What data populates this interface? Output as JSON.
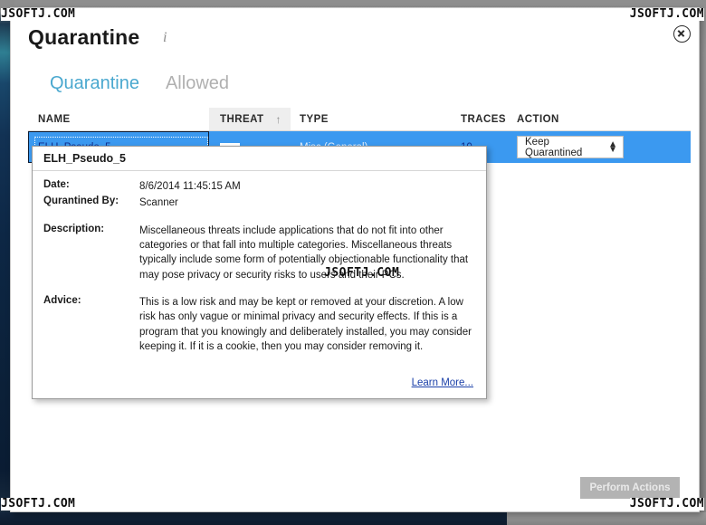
{
  "window": {
    "title": "Quarantine",
    "info_icon": "info-icon",
    "close_icon": "close-icon"
  },
  "tabs": [
    {
      "label": "Quarantine",
      "active": true
    },
    {
      "label": "Allowed",
      "active": false
    }
  ],
  "table": {
    "columns": [
      "NAME",
      "THREAT",
      "TYPE",
      "TRACES",
      "ACTION"
    ],
    "sorted_column": "THREAT",
    "sort_direction": "ascending",
    "sort_arrow": "↑",
    "rows": [
      {
        "name": "ELH_Pseudo_5",
        "threat_level_bar": "low",
        "type": "Misc (General)",
        "traces": "10",
        "action": "Keep Quarantined",
        "selected": true
      }
    ]
  },
  "detail": {
    "title": "ELH_Pseudo_5",
    "date_label": "Date:",
    "date_value": "8/6/2014 11:45:15 AM",
    "quarantined_by_label": "Qurantined By:",
    "quarantined_by_value": "Scanner",
    "description_label": "Description:",
    "description_value": "Miscellaneous threats include applications that do not fit into other categories or that fall into multiple categories. Miscellaneous threats typically include some form of potentially objectionable functionality that may pose privacy or security risks to users and their PCs.",
    "advice_label": "Advice:",
    "advice_value": "This is a low risk and may be kept or removed at your discretion. A low risk has only vague or minimal privacy and security effects. If this is a program that you knowingly and deliberately installed, you may consider keeping it. If it is a cookie, then you may consider removing it.",
    "learn_more": "Learn More..."
  },
  "footer": {
    "perform_actions": "Perform Actions"
  },
  "watermarks": {
    "text": "JSOFTJ.COM"
  },
  "colors": {
    "accent_tab": "#4aa8cf",
    "row_selected": "#3b99f0",
    "link": "#0f2d8c",
    "disabled_button": "#b3b3b3"
  }
}
